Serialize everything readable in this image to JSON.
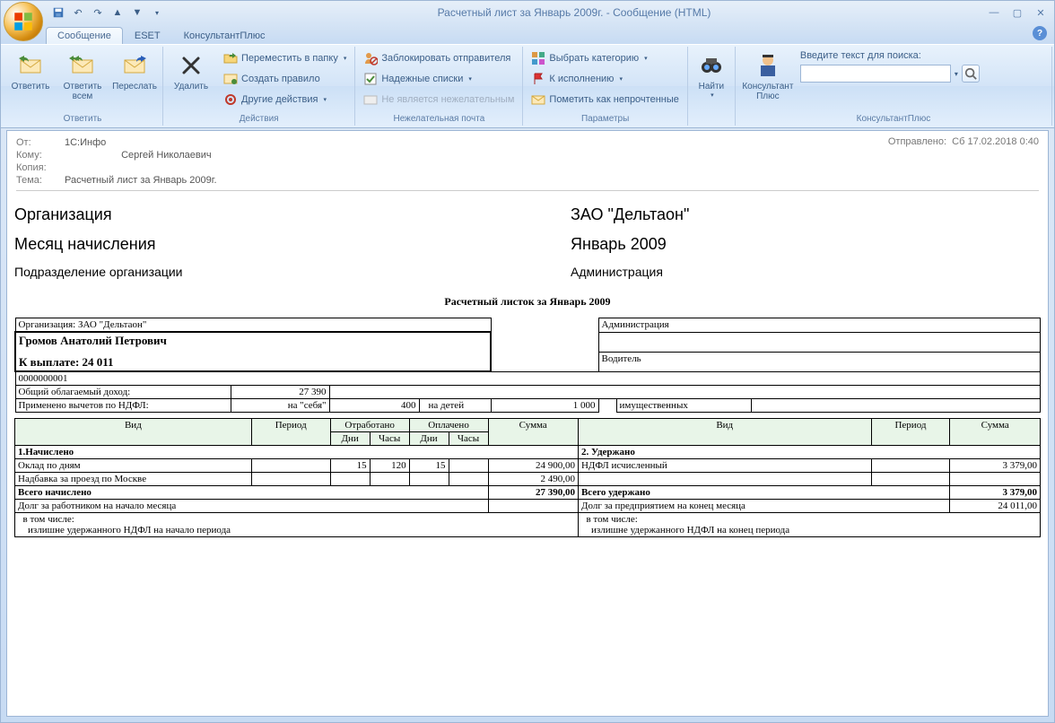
{
  "window": {
    "title": "Расчетный лист за Январь 2009г. - Сообщение (HTML)"
  },
  "tabs": {
    "t1": "Сообщение",
    "t2": "ESET",
    "t3": "КонсультантПлюс"
  },
  "ribbon": {
    "reply": "Ответить",
    "reply_all": "Ответить\nвсем",
    "forward": "Переслать",
    "g_reply": "Ответить",
    "delete": "Удалить",
    "move_folder": "Переместить в папку",
    "create_rule": "Создать правило",
    "other_actions": "Другие действия",
    "g_actions": "Действия",
    "block_sender": "Заблокировать отправителя",
    "safe_lists": "Надежные списки",
    "not_junk": "Не является нежелательным",
    "g_junk": "Нежелательная почта",
    "select_category": "Выбрать категорию",
    "followup": "К исполнению",
    "mark_unread": "Пометить как непрочтенные",
    "g_params": "Параметры",
    "find": "Найти",
    "consultant": "Консультант\nПлюс",
    "search_label": "Введите текст для поиска:",
    "g_consultant": "КонсультантПлюс"
  },
  "message": {
    "from_label": "От:",
    "from_value": "1С:Инфо",
    "to_label": "Кому:",
    "to_value": "Сергей Николаевич",
    "cc_label": "Копия:",
    "subject_label": "Тема:",
    "subject_value": "Расчетный лист за Январь 2009г.",
    "sent_label": "Отправлено:",
    "sent_value": "Сб 17.02.2018 0:40"
  },
  "doc": {
    "org_label": "Организация",
    "org_value": "ЗАО \"Дельтаон\"",
    "month_label": "Месяц начисления",
    "month_value": "Январь 2009",
    "dept_label": "Подразделение организации",
    "dept_value": "Администрация",
    "slip_title": "Расчетный листок за Январь 2009",
    "org_line": "Организация: ЗАО \"Дельтаон\"",
    "admin": "Администрация",
    "person": "Громов Анатолий Петрович",
    "payout": "К выплате: 24 011",
    "position": "Водитель",
    "zeros": "0000000001",
    "taxable_label": "Общий облагаемый доход:",
    "taxable_value": "27 390",
    "deductions_label": "Применено вычетов по НДФЛ:",
    "ded_self_label": "на \"себя\"",
    "ded_self_value": "400",
    "ded_children_label": "на детей",
    "ded_children_value": "1 000",
    "ded_property_label": "имущественных",
    "h_type": "Вид",
    "h_period": "Период",
    "h_worked": "Отработано",
    "h_paid": "Оплачено",
    "h_sum": "Сумма",
    "h_days": "Дни",
    "h_hours": "Часы",
    "accrued": "1.Начислено",
    "withheld": "2. Удержано",
    "row_salary": "Оклад по дням",
    "row_salary_days": "15",
    "row_salary_hours": "120",
    "row_salary_paid_days": "15",
    "row_salary_sum": "24 900,00",
    "row_ndfl": "НДФЛ исчисленный",
    "row_ndfl_sum": "3 379,00",
    "row_bonus": "Надбавка за проезд по Москве",
    "row_bonus_sum": "2 490,00",
    "total_accrued": "Всего начислено",
    "total_accrued_sum": "27 390,00",
    "total_withheld": "Всего удержано",
    "total_withheld_sum": "3 379,00",
    "debt_start": "Долг за работником на начало месяца",
    "debt_end": "Долг за предприятием на конец месяца",
    "debt_end_sum": "24 011,00",
    "incl": "  в том числе:",
    "excess_start": "    излишне удержанного НДФЛ на начало периода",
    "excess_end": "    излишне удержанного НДФЛ на конец периода"
  }
}
